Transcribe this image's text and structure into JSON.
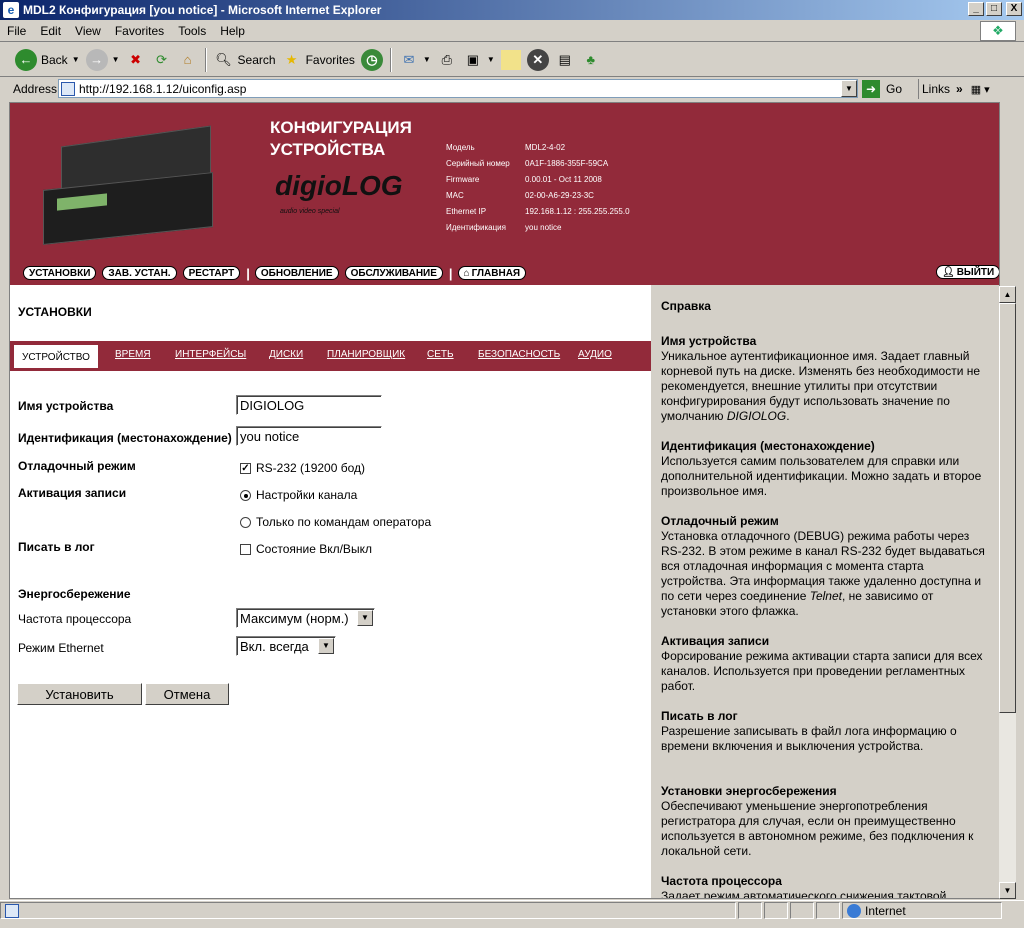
{
  "window": {
    "title": "MDL2 Конфигурация [you notice] - Microsoft Internet Explorer",
    "controls": [
      "_",
      "□",
      "X"
    ]
  },
  "menu": [
    "File",
    "Edit",
    "View",
    "Favorites",
    "Tools",
    "Help"
  ],
  "toolbar": {
    "back": "Back",
    "search": "Search",
    "favorites": "Favorites"
  },
  "address": {
    "label": "Address",
    "url": "http://192.168.1.12/uiconfig.asp",
    "go": "Go",
    "links": "Links"
  },
  "header": {
    "title": "КОНФИГУРАЦИЯ УСТРОЙСТВА",
    "logo": "digioLOG",
    "logo_tagline": "audio video special",
    "device_info": [
      {
        "key": "Модель",
        "value": "MDL2-4-02"
      },
      {
        "key": "Серийный номер",
        "value": "0A1F-1886-355F-59CA"
      },
      {
        "key": "Firmware",
        "value": "0.00.01 - Oct 11 2008"
      },
      {
        "key": "MAC",
        "value": "02-00-A6-29-23-3C"
      },
      {
        "key": "Ethernet IP",
        "value": "192.168.1.12 : 255.255.255.0"
      },
      {
        "key": "Идентификация",
        "value": "you notice"
      }
    ]
  },
  "nav": {
    "settings": "УСТАНОВКИ",
    "factory": "ЗАВ. УСТАН.",
    "restart": "РЕСТАРТ",
    "update": "ОБНОВЛЕНИЕ",
    "service": "ОБСЛУЖИВАНИЕ",
    "home": "ГЛАВНАЯ",
    "exit": "ВЫЙТИ"
  },
  "section_title": "УСТАНОВКИ",
  "tabs": [
    {
      "label": "УСТРОЙСТВО",
      "active": true
    },
    {
      "label": "ВРЕМЯ"
    },
    {
      "label": "ИНТЕРФЕЙСЫ"
    },
    {
      "label": "ДИСКИ"
    },
    {
      "label": "ПЛАНИРОВЩИК"
    },
    {
      "label": "СЕТЬ"
    },
    {
      "label": "БЕЗОПАСНОСТЬ"
    },
    {
      "label": "АУДИО"
    }
  ],
  "form": {
    "device_name_label": "Имя устройства",
    "device_name_value": "DIGIOLOG",
    "ident_label": "Идентификация (местонахождение)",
    "ident_value": "you notice",
    "debug_label": "Отладочный режим",
    "debug_option": "RS-232 (19200 бод)",
    "debug_checked": true,
    "rec_label": "Активация записи",
    "rec_option1": "Настройки канала",
    "rec_option2": "Только по командам оператора",
    "log_label": "Писать в лог",
    "log_option": "Состояние Вкл/Выкл",
    "log_checked": false,
    "power_title": "Энергосбережение",
    "cpu_label": "Частота процессора",
    "cpu_value": "Максимум (норм.)",
    "eth_label": "Режим Ethernet",
    "eth_value": "Вкл. всегда",
    "submit": "Установить",
    "cancel": "Отмена"
  },
  "help": {
    "title": "Справка",
    "sections": [
      {
        "head": "Имя устройства",
        "text": "Уникальное аутентификационное имя. Задает главный корневой путь на диске. Изменять без необходимости не рекомендуется, внешние утилиты при отсутствии конфигурирования будут использовать значение по умолчанию",
        "em": "DIGIOLOG",
        "tail": "."
      },
      {
        "head": "Идентификация (местонахождение)",
        "text": "Используется самим пользователем для справки или дополнительной идентификации. Можно задать и второе произвольное имя.",
        "em": "",
        "tail": ""
      },
      {
        "head": "Отладочный режим",
        "text": "Установка отладочного (DEBUG) режима работы через RS-232. В этом режиме в канал RS-232 будет выдаваться вся отладочная информация с момента старта устройства. Эта информация также удаленно доступна и по сети через соединение",
        "em": "Telnet",
        "tail": ", не зависимо от установки этого флажка."
      },
      {
        "head": "Активация записи",
        "text": "Форсирование режима активации старта записи для всех каналов. Используется при проведении регламентных работ.",
        "em": "",
        "tail": ""
      },
      {
        "head": "Писать в лог",
        "text": "Разрешение записывать в файл лога информацию о времени включения и выключения устройства.",
        "em": "",
        "tail": ""
      },
      {
        "head": "Установки энергосбережения",
        "text": "Обеспечивают уменьшение энергопотребления регистратора для случая, если он преимущественно используется в автономном режиме, без подключения к локальной сети.",
        "em": "",
        "tail": ""
      },
      {
        "head": "Частота процессора",
        "text": "Задает режим автоматического снижения тактовой",
        "em": "",
        "tail": ""
      }
    ]
  },
  "status": {
    "zone": "Internet"
  }
}
